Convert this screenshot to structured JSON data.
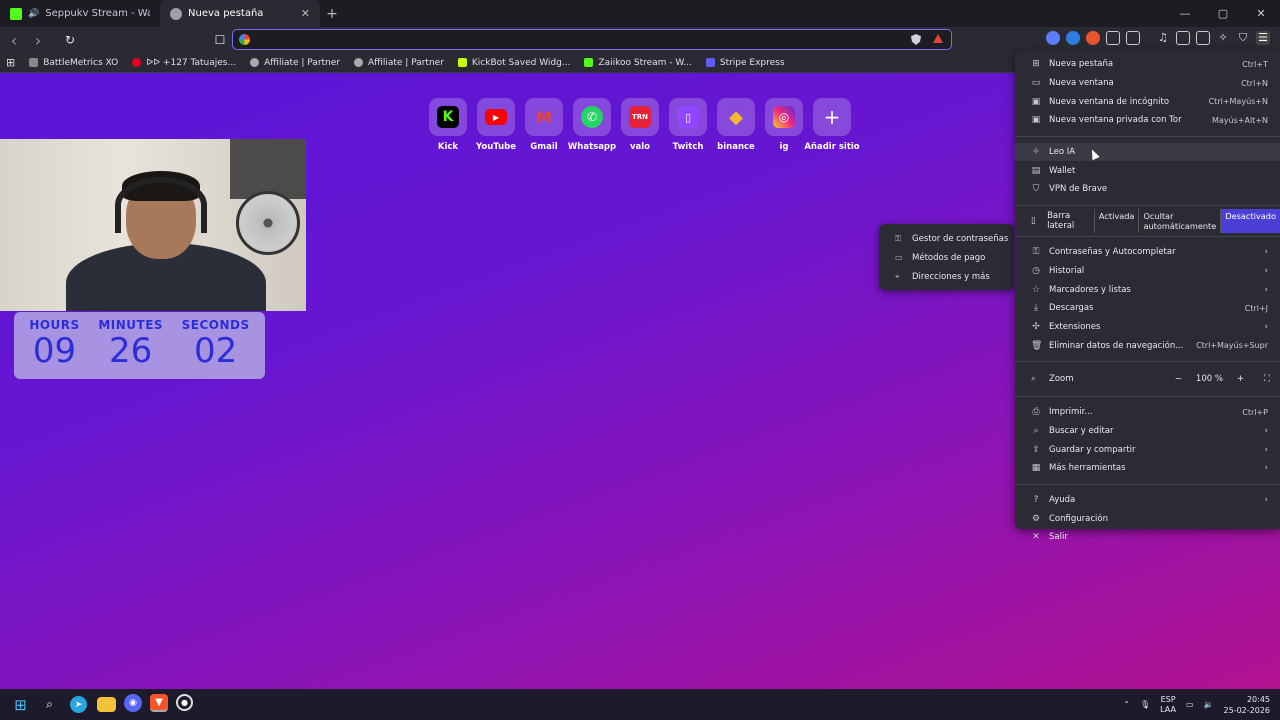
{
  "tabs": [
    {
      "title": "Seppukv Stream - Watch Live on",
      "favicon_color": "#53fc18"
    },
    {
      "title": "Nueva pestaña",
      "favicon_color": "#a0a0a8"
    }
  ],
  "window_controls": {
    "minimize": "—",
    "maximize": "▢",
    "close": "✕"
  },
  "toolbar": {
    "back": "‹",
    "forward": "›",
    "reload": "↻",
    "bookmark": "☐",
    "address_value": "",
    "address_placeholder": ""
  },
  "bookmarks": [
    {
      "label": "BattleMetrics XO",
      "color": "#888"
    },
    {
      "label": "ᐅᐅ +127 Tatuajes...",
      "color": "#e60023"
    },
    {
      "label": "Affiliate | Partner",
      "color": "#aaa"
    },
    {
      "label": "Affiliate | Partner",
      "color": "#aaa"
    },
    {
      "label": "KickBot Saved Widg...",
      "color": "#c8ff00"
    },
    {
      "label": "Zaiikoo Stream - W...",
      "color": "#53fc18"
    },
    {
      "label": "Stripe Express",
      "color": "#635bff"
    }
  ],
  "shortcuts": [
    {
      "label": "Kick",
      "glyph": "K",
      "bg": "#000000",
      "fg": "#53fc18"
    },
    {
      "label": "YouTube",
      "glyph": "▶",
      "bg": "#ff0000",
      "fg": "#ffffff"
    },
    {
      "label": "Gmail",
      "glyph": "M",
      "bg": "#ffffff",
      "fg": "#ea4335"
    },
    {
      "label": "Whatsapp",
      "glyph": "✆",
      "bg": "#25d366",
      "fg": "#ffffff"
    },
    {
      "label": "valo",
      "glyph": "TRN",
      "bg": "#e8213a",
      "fg": "#ffffff"
    },
    {
      "label": "Twitch",
      "glyph": "☐",
      "bg": "#9146ff",
      "fg": "#ffffff"
    },
    {
      "label": "binance",
      "glyph": "◆",
      "bg": "#f3ba2f",
      "fg": "#ffffff"
    },
    {
      "label": "ig",
      "glyph": "◎",
      "bg": "#d6249f",
      "fg": "#ffffff"
    },
    {
      "label": "Añadir sitio",
      "glyph": "+",
      "bg": "transparent",
      "fg": "#ffffff"
    }
  ],
  "timer": {
    "hours_label": "HOURS",
    "hours": "09",
    "minutes_label": "MINUTES",
    "minutes": "26",
    "seconds_label": "SECONDS",
    "seconds": "02"
  },
  "menu": {
    "items1": [
      {
        "label": "Nueva pestaña",
        "shortcut": "Ctrl+T",
        "icon": "⊞"
      },
      {
        "label": "Nueva ventana",
        "shortcut": "Ctrl+N",
        "icon": "▭"
      },
      {
        "label": "Nueva ventana de incógnito",
        "shortcut": "Ctrl+Mayús+N",
        "icon": "▣"
      },
      {
        "label": "Nueva ventana privada con Tor",
        "shortcut": "Mayús+Alt+N",
        "icon": "▣"
      }
    ],
    "items2": [
      {
        "label": "Leo IA",
        "icon": "✧"
      },
      {
        "label": "Wallet",
        "icon": "▤"
      },
      {
        "label": "VPN de Brave",
        "icon": "⛉"
      }
    ],
    "sidebar": {
      "label": "Barra lateral",
      "opt1": "Activada",
      "opt2": "Ocultar automáticamente",
      "opt3": "Desactivado"
    },
    "items3": [
      {
        "label": "Contraseñas y Autocompletar",
        "shortcut": "",
        "icon": "⚿",
        "arrow": "›"
      },
      {
        "label": "Historial",
        "shortcut": "",
        "icon": "◷",
        "arrow": "›"
      },
      {
        "label": "Marcadores y listas",
        "shortcut": "",
        "icon": "☆",
        "arrow": "›"
      },
      {
        "label": "Descargas",
        "shortcut": "Ctrl+J",
        "icon": "⤓",
        "arrow": ""
      },
      {
        "label": "Extensiones",
        "shortcut": "",
        "icon": "✣",
        "arrow": "›"
      },
      {
        "label": "Eliminar datos de navegación...",
        "shortcut": "Ctrl+Mayús+Supr",
        "icon": "🗑",
        "arrow": ""
      }
    ],
    "zoom": {
      "label": "Zoom",
      "minus": "−",
      "value": "100 %",
      "plus": "+",
      "fullscreen": "⛶"
    },
    "items4": [
      {
        "label": "Imprimir...",
        "shortcut": "Ctrl+P",
        "icon": "⎙",
        "arrow": ""
      },
      {
        "label": "Buscar y editar",
        "shortcut": "",
        "icon": "⌕",
        "arrow": "›"
      },
      {
        "label": "Guardar y compartir",
        "shortcut": "",
        "icon": "⇪",
        "arrow": "›"
      },
      {
        "label": "Más herramientas",
        "shortcut": "",
        "icon": "▦",
        "arrow": "›"
      }
    ],
    "items5": [
      {
        "label": "Ayuda",
        "icon": "?",
        "arrow": "›"
      },
      {
        "label": "Configuración",
        "icon": "⚙",
        "arrow": ""
      },
      {
        "label": "Salir",
        "icon": "✕",
        "arrow": ""
      }
    ]
  },
  "submenu": [
    {
      "label": "Gestor de contraseñas",
      "icon": "⚿"
    },
    {
      "label": "Métodos de pago",
      "icon": "▭"
    },
    {
      "label": "Direcciones y más",
      "icon": "⌖"
    }
  ],
  "tray": {
    "lang1": "ESP",
    "lang2": "LAA",
    "time": "20:45",
    "date": "25-02-2026"
  }
}
